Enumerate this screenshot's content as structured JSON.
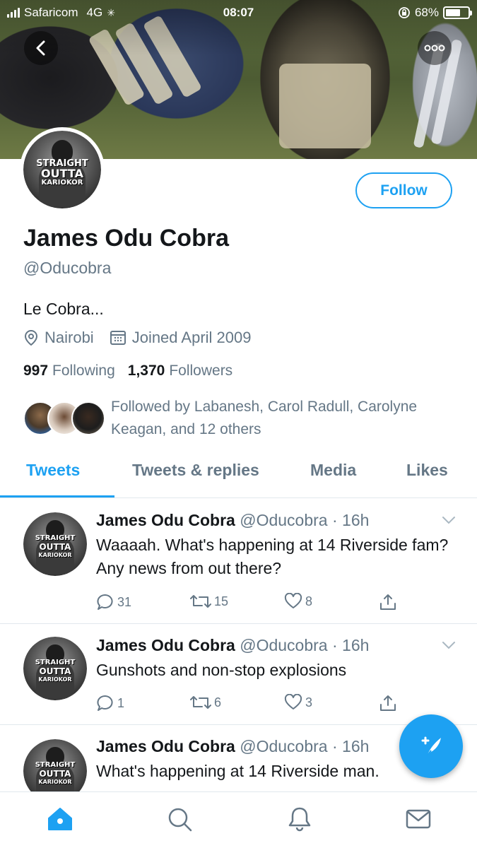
{
  "status_bar": {
    "carrier": "Safaricom",
    "network": "4G",
    "time": "08:07",
    "battery": "68%",
    "battery_level": 0.68
  },
  "header": {
    "back_icon": "chevron-left-icon",
    "more_icon": "more-dots-icon"
  },
  "profile": {
    "avatar_lettering": [
      "STRAIGHT",
      "OUTTA",
      "KARIOKOR"
    ],
    "follow_label": "Follow",
    "name": "James Odu Cobra",
    "handle": "@Oducobra",
    "bio": "Le Cobra...",
    "location": "Nairobi",
    "joined": "Joined April 2009",
    "following_count": "997",
    "following_label": "Following",
    "followers_count": "1,370",
    "followers_label": "Followers",
    "followed_by": "Followed by Labanesh, Carol Radull, Carolyne Keagan, and 12 others"
  },
  "tabs": [
    {
      "label": "Tweets",
      "active": true
    },
    {
      "label": "Tweets & replies",
      "active": false
    },
    {
      "label": "Media",
      "active": false
    },
    {
      "label": "Likes",
      "active": false
    }
  ],
  "tweets": [
    {
      "name": "James Odu Cobra",
      "handle": "@Oducobra",
      "time": "16h",
      "text": "Waaaah. What's happening at 14 Riverside fam? Any news from out there?",
      "replies": "31",
      "retweets": "15",
      "likes": "8"
    },
    {
      "name": "James Odu Cobra",
      "handle": "@Oducobra",
      "time": "16h",
      "text": "Gunshots and non-stop explosions",
      "replies": "1",
      "retweets": "6",
      "likes": "3"
    },
    {
      "name": "James Odu Cobra",
      "handle": "@Oducobra",
      "time": "16h",
      "text": "What's happening at 14 Riverside man."
    }
  ],
  "colors": {
    "accent": "#1da1f2",
    "secondary_text": "#657786",
    "primary_text": "#14171a",
    "divider": "#e1e8ed"
  },
  "bottom_nav": [
    "home-icon",
    "search-icon",
    "notifications-icon",
    "messages-icon"
  ]
}
